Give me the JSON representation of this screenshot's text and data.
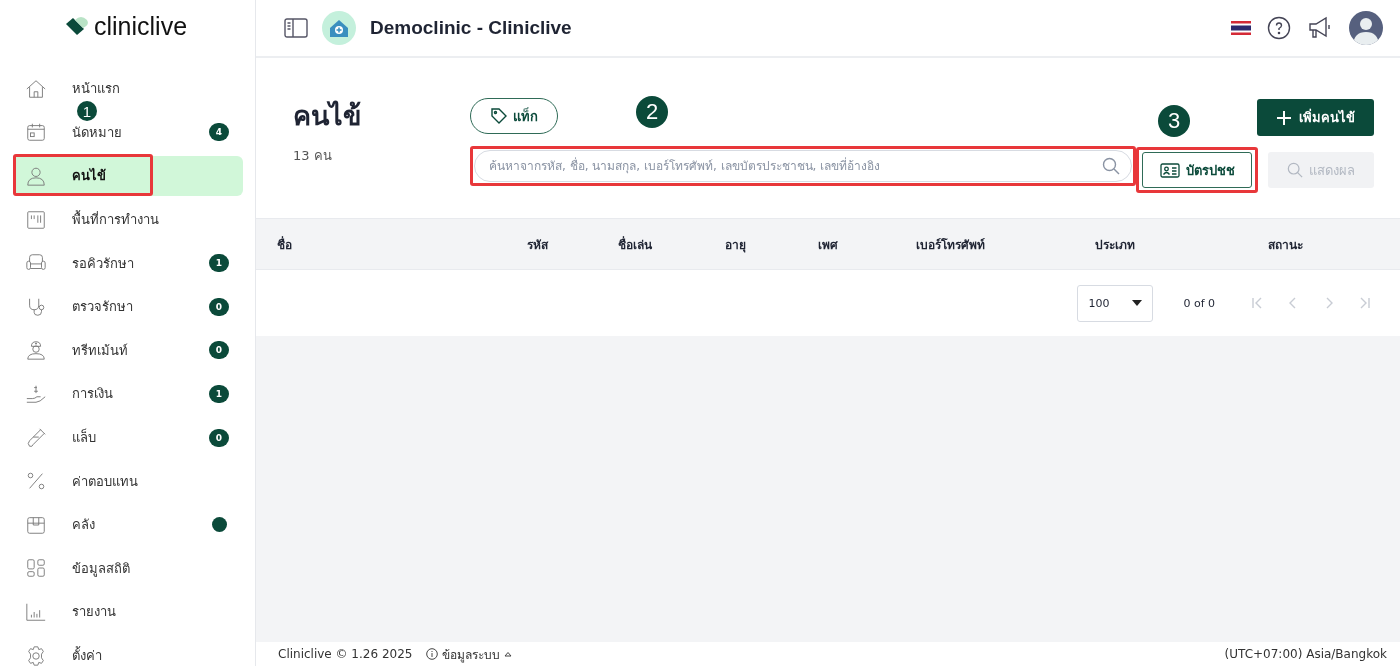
{
  "brand": {
    "name": "cliniclive"
  },
  "sidebar": {
    "items": [
      {
        "label": "หน้าแรก",
        "selected": false,
        "highlighted": false
      },
      {
        "label": "นัดหมาย",
        "selected": false,
        "highlighted": false,
        "badge": "4"
      },
      {
        "label": "คนไข้",
        "selected": true,
        "highlighted": true,
        "callout": "1"
      },
      {
        "label": "พื้นที่การทำงาน",
        "selected": false,
        "highlighted": false
      },
      {
        "label": "รอคิวรักษา",
        "selected": false,
        "highlighted": false,
        "badge": "1"
      },
      {
        "label": "ตรวจรักษา",
        "selected": false,
        "highlighted": false,
        "badge": "0"
      },
      {
        "label": "ทรีทเม้นท์",
        "selected": false,
        "highlighted": false,
        "badge": "0"
      },
      {
        "label": "การเงิน",
        "selected": false,
        "highlighted": false,
        "badge": "1"
      },
      {
        "label": "แล็บ",
        "selected": false,
        "highlighted": false,
        "badge": "0"
      },
      {
        "label": "ค่าตอบแทน",
        "selected": false,
        "highlighted": false
      },
      {
        "label": "คลัง",
        "selected": false,
        "highlighted": false,
        "dot": true
      },
      {
        "label": "ข้อมูลสถิติ",
        "selected": false,
        "highlighted": false
      },
      {
        "label": "รายงาน",
        "selected": false,
        "highlighted": false
      },
      {
        "label": "ตั้งค่า",
        "selected": false,
        "highlighted": false
      }
    ]
  },
  "header": {
    "title": "Democlinic - Cliniclive"
  },
  "page": {
    "title": "คนไข้",
    "count": "13 คน"
  },
  "tag_button": {
    "label": "แท็ก"
  },
  "search": {
    "placeholder": "ค้นหาจากรหัส, ชื่อ, นามสกุล, เบอร์โทรศัพท์, เลขบัตรประชาชน, เลขที่อ้างอิง",
    "highlighted": true,
    "callout": "2"
  },
  "id_card_button": {
    "label": "บัตรปชช",
    "highlighted": true,
    "callout": "3"
  },
  "add_button": {
    "label": "เพิ่มคนไข้"
  },
  "show_button": {
    "label": "แสดงผล",
    "disabled": true
  },
  "table": {
    "columns": [
      "ชื่อ",
      "รหัส",
      "ชื่อเล่น",
      "อายุ",
      "เพศ",
      "เบอร์โทรศัพท์",
      "ประเภท",
      "สถานะ"
    ]
  },
  "pagination": {
    "page_size": "100",
    "range": "0 of 0",
    "first_disabled": true,
    "prev_disabled": true,
    "next_disabled": true,
    "last_disabled": true
  },
  "footer": {
    "copyright": "Cliniclive © 1.26 2025",
    "system_info": "ข้อมูลระบบ",
    "timezone": "(UTC+07:00) Asia/Bangkok"
  }
}
